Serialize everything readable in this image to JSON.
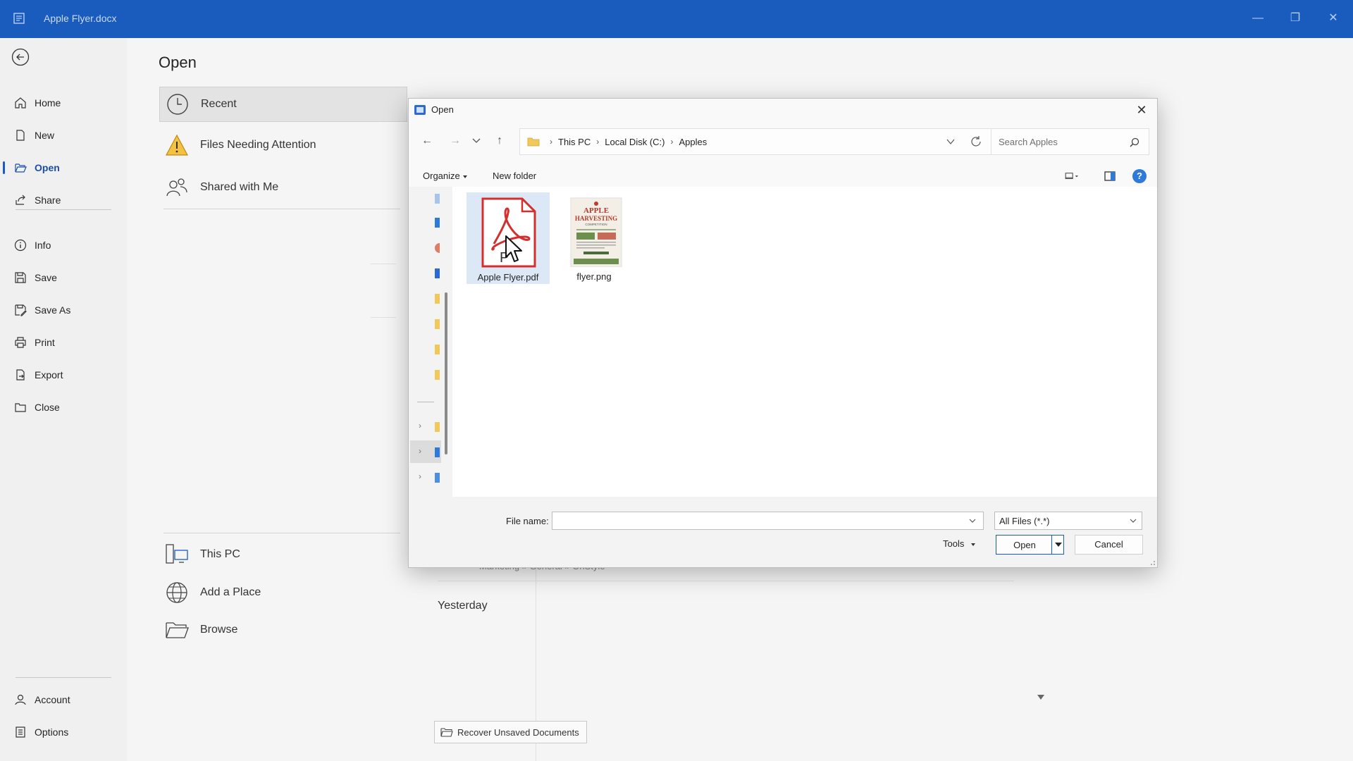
{
  "window": {
    "title": "Apple Flyer.docx"
  },
  "nav": {
    "items": [
      {
        "label": "Home",
        "icon": "home-icon"
      },
      {
        "label": "New",
        "icon": "new-document-icon"
      },
      {
        "label": "Open",
        "icon": "open-folder-icon"
      },
      {
        "label": "Share",
        "icon": "share-icon"
      },
      {
        "label": "Info",
        "icon": "info-icon"
      },
      {
        "label": "Save",
        "icon": "save-icon"
      },
      {
        "label": "Save As",
        "icon": "save-as-icon"
      },
      {
        "label": "Print",
        "icon": "print-icon"
      },
      {
        "label": "Export",
        "icon": "export-icon"
      },
      {
        "label": "Close",
        "icon": "close-folder-icon"
      }
    ],
    "bottom": [
      {
        "label": "Account",
        "icon": "account-icon"
      },
      {
        "label": "Options",
        "icon": "options-icon"
      }
    ]
  },
  "main": {
    "title": "Open",
    "locations": [
      {
        "label": "Recent",
        "icon": "clock-icon"
      },
      {
        "label": "Files Needing Attention",
        "icon": "warning-icon"
      },
      {
        "label": "Shared with Me",
        "icon": "people-icon"
      }
    ],
    "places": [
      {
        "label": "This PC",
        "icon": "computer-icon"
      },
      {
        "label": "Add a Place",
        "icon": "globe-icon"
      },
      {
        "label": "Browse",
        "icon": "folder-icon"
      }
    ],
    "recent_path": "Marketing » General » OnStyle",
    "yesterday": "Yesterday",
    "recover_label": "Recover Unsaved Documents"
  },
  "dialog": {
    "title": "Open",
    "breadcrumb": [
      "This PC",
      "Local Disk (C:)",
      "Apples"
    ],
    "search_placeholder": "Search Apples",
    "organize": "Organize",
    "new_folder": "New folder",
    "help": "?",
    "files": [
      {
        "name": "Apple Flyer.pdf",
        "type": "pdf"
      },
      {
        "name": "flyer.png",
        "type": "png"
      }
    ],
    "flyer_thumb": {
      "line1": "APPLE",
      "line2": "HARVESTING",
      "line3": "COMPETITION"
    },
    "file_name_label": "File name:",
    "file_name_value": "",
    "filter": "All Files (*.*)",
    "tools": "Tools",
    "open_label": "Open",
    "cancel_label": "Cancel"
  },
  "colors": {
    "accent": "#1a5cbe",
    "pdf_red": "#d32f2f"
  }
}
